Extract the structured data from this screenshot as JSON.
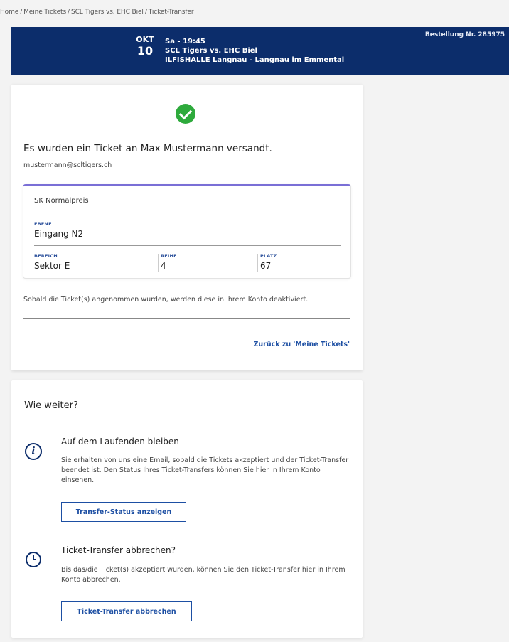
{
  "breadcrumb": {
    "items": [
      "Home",
      "Meine Tickets",
      "SCL Tigers vs. EHC Biel",
      "Ticket-Transfer"
    ]
  },
  "event": {
    "month": "OKT",
    "day": "10",
    "time": "Sa - 19:45",
    "title": "SCL Tigers vs. EHC Biel",
    "venue": "ILFISHALLE Langnau - Langnau im Emmental",
    "order_number": "Bestellung Nr. 285975"
  },
  "confirmation": {
    "icon": "check-circle-icon",
    "title": "Es wurden ein Ticket an Max Mustermann versandt.",
    "email": "mustermann@scltigers.ch",
    "ticket": {
      "type": "SK Normalpreis",
      "ebene_label": "EBENE",
      "ebene_value": "Eingang N2",
      "bereich_label": "BEREICH",
      "bereich_value": "Sektor E",
      "reihe_label": "REIHE",
      "reihe_value": "4",
      "platz_label": "PLATZ",
      "platz_value": "67"
    },
    "notice": "Sobald die Ticket(s) angenommen wurden, werden diese in Ihrem Konto deaktiviert.",
    "back_link": "Zurück zu 'Meine Tickets'"
  },
  "next_steps": {
    "title": "Wie weiter?",
    "steps": [
      {
        "icon": "info-icon",
        "title": "Auf dem Laufenden bleiben",
        "text": "Sie erhalten von uns eine Email, sobald die Tickets akzeptiert und der Ticket-Transfer beendet ist. Den Status Ihres Ticket-Transfers können Sie hier in Ihrem Konto einsehen.",
        "button": "Transfer-Status anzeigen"
      },
      {
        "icon": "clock-icon",
        "title": "Ticket-Transfer abbrechen?",
        "text": "Bis das/die Ticket(s) akzeptiert wurden, können Sie den Ticket-Transfer hier in Ihrem Konto abbrechen.",
        "button": "Ticket-Transfer abbrechen"
      }
    ]
  },
  "colors": {
    "brand_navy": "#0c2d6b",
    "link_blue": "#1d4fa3",
    "success_green": "#2eaa3c",
    "ticket_accent": "#7a6fd6"
  }
}
